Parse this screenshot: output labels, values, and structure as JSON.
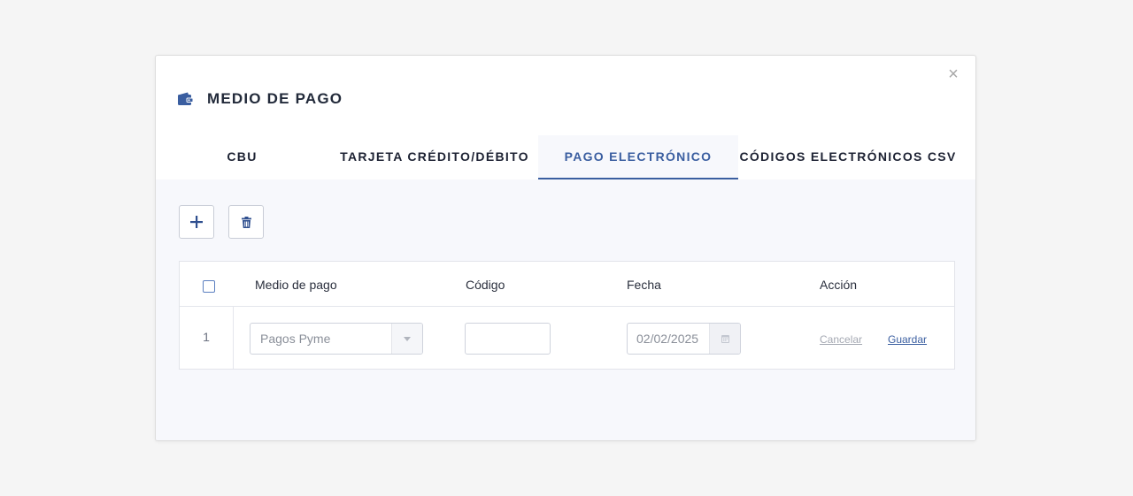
{
  "modal": {
    "title": "MEDIO DE PAGO",
    "close_glyph": "×",
    "header_icon": "wallet-icon"
  },
  "tabs": [
    {
      "label": "CBU",
      "active": false
    },
    {
      "label": "TARJETA CRÉDITO/DÉBITO",
      "active": false
    },
    {
      "label": "PAGO ELECTRÓNICO",
      "active": true
    },
    {
      "label": "CÓDIGOS ELECTRÓNICOS CSV",
      "active": false
    }
  ],
  "toolbar": {
    "add_icon": "plus-icon",
    "delete_icon": "trash-icon"
  },
  "table": {
    "columns": [
      "Medio de pago",
      "Código",
      "Fecha",
      "Acción"
    ],
    "rows": [
      {
        "index": "1",
        "medio_de_pago": "Pagos Pyme",
        "codigo": "",
        "fecha": "02/02/2025",
        "cancel_label": "Cancelar",
        "save_label": "Guardar"
      }
    ]
  },
  "colors": {
    "accent": "#3a5ea0",
    "text_dark": "#1d2233",
    "content_bg": "#f7f8fc",
    "muted": "#8a8f99"
  }
}
